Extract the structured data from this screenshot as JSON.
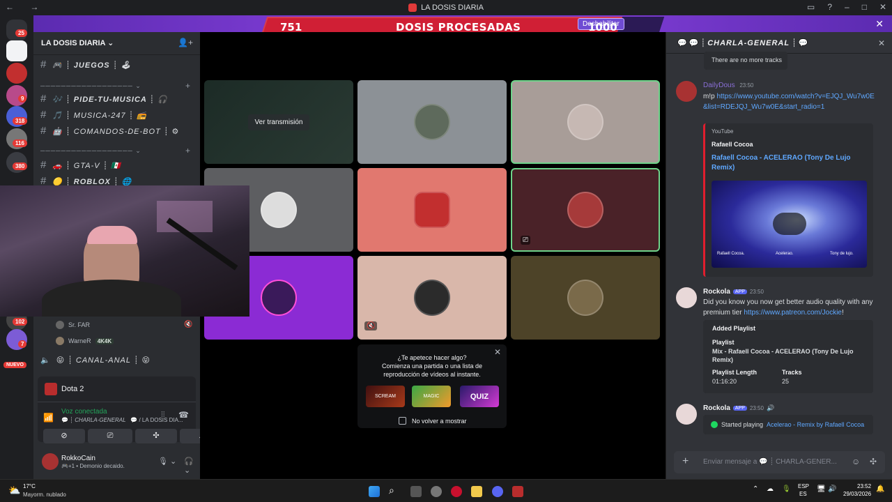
{
  "window": {
    "title": "LA DOSIS DIARIA"
  },
  "banner": {
    "left_num": "751",
    "title": "DOSIS PROCESADAS",
    "disable_label": "Deshabilitar",
    "right_num": "1000"
  },
  "rail": {
    "badges": [
      "25",
      "9",
      "318",
      "116",
      "380",
      "102",
      "7"
    ],
    "new_label": "NUEVO"
  },
  "server": {
    "name": "LA DOSIS DIARIA"
  },
  "channels": [
    {
      "emoji": "🎮",
      "name": "JUEGOS",
      "suffix": "🕹"
    },
    {
      "emoji": "🎶",
      "name": "PIDE-TU-MUSICA",
      "suffix": "🎧"
    },
    {
      "emoji": "🎵",
      "name": "MUSICA-247",
      "suffix": "📻"
    },
    {
      "emoji": "🤖",
      "name": "COMANDOS-DE-BOT",
      "suffix": "⚙"
    },
    {
      "emoji": "🚗",
      "name": "GTA-V",
      "suffix": "🇲🇽"
    },
    {
      "emoji": "🟡",
      "name": "ROBLOX",
      "suffix": "🌐"
    }
  ],
  "voice_users": [
    {
      "name": "Sr. FAR"
    },
    {
      "name": "WarneR",
      "tag": "4K4K"
    }
  ],
  "voice_channel": {
    "name": "CANAL-ANAL"
  },
  "activity": {
    "game": "Dota 2"
  },
  "voice": {
    "status": "Voz conectada",
    "channel": "CHARLA-GENERAL",
    "server": "/ LA DOSIS DIA..."
  },
  "user": {
    "name": "RokkoCain",
    "status": "Demonio decaido."
  },
  "stage": {
    "watch_label": "Ver transmisión"
  },
  "promo": {
    "line1": "¿Te apetece hacer algo?",
    "line2": "Comienza una partida o una lista de",
    "line3": "reproducción de vídeos al instante.",
    "checkbox": "No volver a mostrar",
    "games": [
      "SCREAM",
      "MAGIC",
      "QUIZ"
    ]
  },
  "chat": {
    "header": "CHARLA-GENERAL",
    "no_tracks": "There are no more tracks",
    "m1": {
      "author": "DailyDous",
      "time": "23:50",
      "prefix": "m!p",
      "url": "https://www.youtube.com/watch?v=EJQJ_Wu7w0E&list=RDEJQJ_Wu7w0E&start_radio=1",
      "embed": {
        "provider": "YouTube",
        "channel": "Rafaell Cocoa",
        "title": "Rafaell Cocoa - ACELERAO (Tony De Lujo Remix)",
        "thumb_labels": [
          "Rafaell Cocoa.",
          "Acelerao.",
          "Tony de lujo."
        ]
      }
    },
    "m2": {
      "author": "Rockola",
      "tag": "APP",
      "time": "23:50",
      "text": "Did you know you now get better audio quality with any premium tier",
      "url": "https://www.patreon.com/Jockie",
      "excl": "!",
      "embed": {
        "title": "Added Playlist",
        "pl_label": "Playlist",
        "pl_value": "Mix - Rafaell Cocoa - ACELERAO (Tony De Lujo Remix)",
        "len_label": "Playlist Length",
        "len_value": "01:16:20",
        "tracks_label": "Tracks",
        "tracks_value": "25"
      }
    },
    "m3": {
      "author": "Rockola",
      "tag": "APP",
      "time": "23:50",
      "text": "Started playing",
      "song": "Acelerao - Remix by Rafaell Cocoa"
    },
    "input_placeholder": "Enviar mensaje a 💬 ┊ CHARLA-GENER..."
  },
  "taskbar": {
    "weather_temp": "17°C",
    "weather_desc": "Mayorm. nublado",
    "lang1": "ESP",
    "lang2": "ES",
    "time": "23:52",
    "date": "29/03/2026"
  }
}
